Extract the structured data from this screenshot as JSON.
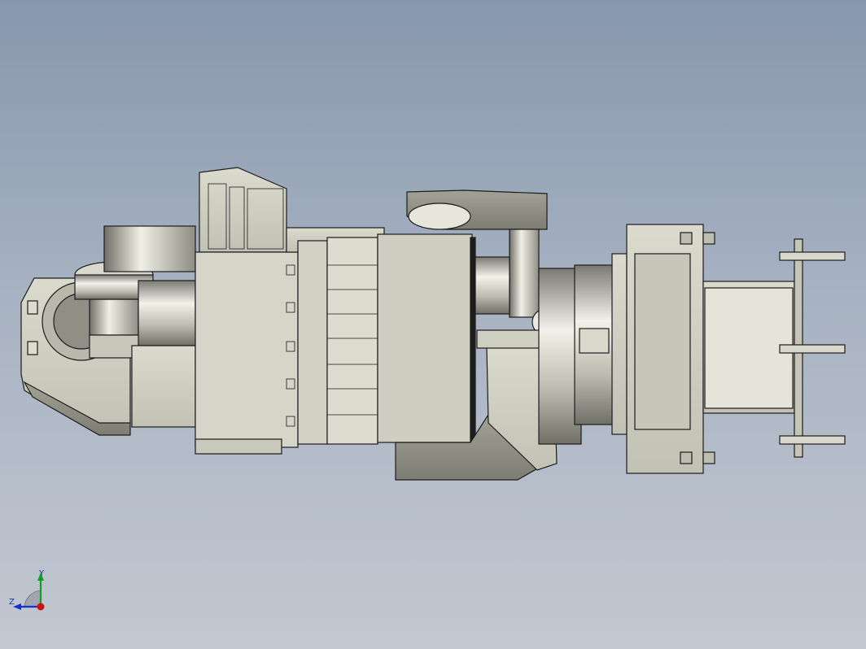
{
  "viewport": {
    "background_top": "#8797ad",
    "background_bottom": "#c3c8d1"
  },
  "model": {
    "parts": [
      "base-housing",
      "wrist-joint",
      "motor-drum",
      "main-housing",
      "cover-panel-grid",
      "upper-arm-link",
      "lower-arm-link",
      "flange-drum",
      "mounting-plate",
      "bolt-assembly"
    ],
    "colors": {
      "body": "#cfcfc2",
      "body_light": "#e6e6dc",
      "body_shadow": "#8c8c82",
      "outline": "#1c1c1c"
    }
  },
  "triad": {
    "x_label": "",
    "y_label": "Y",
    "z_label": "Z",
    "icon": "coordinate-triad-icon",
    "colors": {
      "x": "#d01010",
      "y": "#10a020",
      "z": "#1030d0"
    }
  }
}
